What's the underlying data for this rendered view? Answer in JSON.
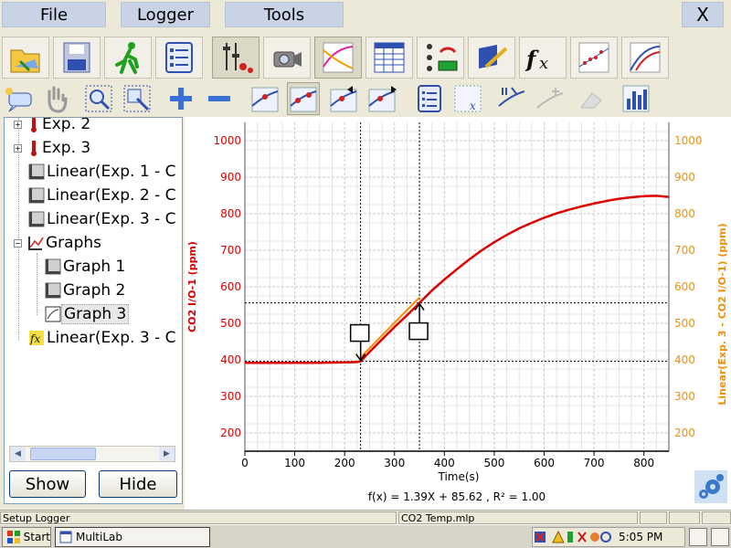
{
  "menubar": {
    "file": "File",
    "logger": "Logger",
    "tools": "Tools",
    "close": "X"
  },
  "toolbar1": [
    "open-folder-icon",
    "save-disk-icon",
    "run-logger-icon",
    "list-icon",
    "setup-icon",
    "camera-icon",
    "graph-view-icon",
    "table-view-icon",
    "meter-icon",
    "notebook-icon",
    "function-icon",
    "scatter-icon",
    "curve-icon"
  ],
  "tree": {
    "items": [
      "Exp. 2",
      "Exp. 3",
      "Linear(Exp. 1 - C",
      "Linear(Exp. 2 - C",
      "Linear(Exp. 3 - C",
      "Graphs",
      "Graph 1",
      "Graph 2",
      "Graph 3",
      "Linear(Exp. 3 - C"
    ]
  },
  "panel": {
    "show": "Show",
    "hide": "Hide"
  },
  "chart_data": {
    "type": "line",
    "xlabel": "Time(s)",
    "ylabel": "CO2 I/O-1 (ppm)",
    "ylabel_right": "Linear(Exp. 3 - CO2 I/O-1) (ppm)",
    "xlim": [
      0,
      850
    ],
    "ylim": [
      150,
      1050
    ],
    "xticks": [
      "0",
      "100",
      "200",
      "300",
      "400",
      "500",
      "600",
      "700",
      "800"
    ],
    "yticks": [
      "200",
      "300",
      "400",
      "500",
      "600",
      "700",
      "800",
      "900",
      "1000"
    ],
    "grid": true,
    "series": [
      {
        "color": "#dd0000",
        "x": [
          0,
          50,
          100,
          150,
          200,
          225,
          232,
          250,
          275,
          300,
          325,
          350,
          375,
          400,
          425,
          450,
          475,
          500,
          525,
          550,
          575,
          600,
          625,
          650,
          675,
          700,
          725,
          750,
          775,
          800,
          825,
          850
        ],
        "y": [
          392,
          392,
          392,
          392,
          393,
          394,
          396,
          422,
          456,
          490,
          522,
          556,
          590,
          620,
          648,
          675,
          700,
          722,
          742,
          760,
          775,
          789,
          801,
          811,
          820,
          828,
          835,
          841,
          845,
          848,
          849,
          846
        ]
      },
      {
        "color": "#ff8c00",
        "x": [
          232,
          350
        ],
        "y": [
          407,
          571
        ]
      }
    ],
    "cursors": [
      {
        "x": 232,
        "y": 396
      },
      {
        "x": 350,
        "y": 556
      }
    ],
    "formula": "f(x) = 1.39X + 85.62 ,  R² = 1.00"
  },
  "statusbar": {
    "left": "Setup Logger",
    "file": "CO2 Temp.mlp"
  },
  "taskbar": {
    "start": "Start",
    "task": "MultiLab",
    "clock": "5:05 PM"
  },
  "colors": {
    "left_axis": "#dd0000",
    "right_axis": "#f0900a"
  }
}
